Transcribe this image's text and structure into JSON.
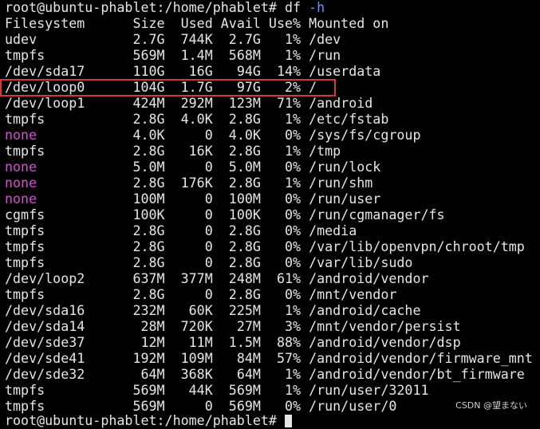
{
  "terminal": {
    "prompt": "root@ubuntu-phablet:/home/phablet# ",
    "command": "df ",
    "command_flag": "-h",
    "headers": [
      "Filesystem",
      "Size",
      "Used",
      "Avail",
      "Use%",
      "Mounted on"
    ],
    "highlighted_row_index": 3,
    "highlight_color": "#d23a3a",
    "none_color": "#d34fd3",
    "rows": [
      {
        "fs": "udev",
        "size": "2.7G",
        "used": "744K",
        "avail": "2.7G",
        "use": "1%",
        "mount": "/dev"
      },
      {
        "fs": "tmpfs",
        "size": "569M",
        "used": "1.4M",
        "avail": "568M",
        "use": "1%",
        "mount": "/run"
      },
      {
        "fs": "/dev/sda17",
        "size": "110G",
        "used": "16G",
        "avail": "94G",
        "use": "14%",
        "mount": "/userdata"
      },
      {
        "fs": "/dev/loop0",
        "size": "104G",
        "used": "1.7G",
        "avail": "97G",
        "use": "2%",
        "mount": "/"
      },
      {
        "fs": "/dev/loop1",
        "size": "424M",
        "used": "292M",
        "avail": "123M",
        "use": "71%",
        "mount": "/android"
      },
      {
        "fs": "tmpfs",
        "size": "2.8G",
        "used": "4.0K",
        "avail": "2.8G",
        "use": "1%",
        "mount": "/etc/fstab"
      },
      {
        "fs": "none",
        "size": "4.0K",
        "used": "0",
        "avail": "4.0K",
        "use": "0%",
        "mount": "/sys/fs/cgroup"
      },
      {
        "fs": "tmpfs",
        "size": "2.8G",
        "used": "16K",
        "avail": "2.8G",
        "use": "1%",
        "mount": "/tmp"
      },
      {
        "fs": "none",
        "size": "5.0M",
        "used": "0",
        "avail": "5.0M",
        "use": "0%",
        "mount": "/run/lock"
      },
      {
        "fs": "none",
        "size": "2.8G",
        "used": "176K",
        "avail": "2.8G",
        "use": "1%",
        "mount": "/run/shm"
      },
      {
        "fs": "none",
        "size": "100M",
        "used": "0",
        "avail": "100M",
        "use": "0%",
        "mount": "/run/user"
      },
      {
        "fs": "cgmfs",
        "size": "100K",
        "used": "0",
        "avail": "100K",
        "use": "0%",
        "mount": "/run/cgmanager/fs"
      },
      {
        "fs": "tmpfs",
        "size": "2.8G",
        "used": "0",
        "avail": "2.8G",
        "use": "0%",
        "mount": "/media"
      },
      {
        "fs": "tmpfs",
        "size": "2.8G",
        "used": "0",
        "avail": "2.8G",
        "use": "0%",
        "mount": "/var/lib/openvpn/chroot/tmp"
      },
      {
        "fs": "tmpfs",
        "size": "2.8G",
        "used": "0",
        "avail": "2.8G",
        "use": "0%",
        "mount": "/var/lib/sudo"
      },
      {
        "fs": "/dev/loop2",
        "size": "637M",
        "used": "377M",
        "avail": "248M",
        "use": "61%",
        "mount": "/android/vendor"
      },
      {
        "fs": "tmpfs",
        "size": "2.8G",
        "used": "0",
        "avail": "2.8G",
        "use": "0%",
        "mount": "/mnt/vendor"
      },
      {
        "fs": "/dev/sda16",
        "size": "232M",
        "used": "60K",
        "avail": "225M",
        "use": "1%",
        "mount": "/android/cache"
      },
      {
        "fs": "/dev/sda14",
        "size": "28M",
        "used": "720K",
        "avail": "27M",
        "use": "3%",
        "mount": "/mnt/vendor/persist"
      },
      {
        "fs": "/dev/sde37",
        "size": "12M",
        "used": "11M",
        "avail": "1.5M",
        "use": "88%",
        "mount": "/android/vendor/dsp"
      },
      {
        "fs": "/dev/sde41",
        "size": "192M",
        "used": "109M",
        "avail": "84M",
        "use": "57%",
        "mount": "/android/vendor/firmware_mnt"
      },
      {
        "fs": "/dev/sde32",
        "size": "64M",
        "used": "368K",
        "avail": "64M",
        "use": "1%",
        "mount": "/android/vendor/bt_firmware"
      },
      {
        "fs": "tmpfs",
        "size": "569M",
        "used": "44K",
        "avail": "569M",
        "use": "1%",
        "mount": "/run/user/32011"
      },
      {
        "fs": "tmpfs",
        "size": "569M",
        "used": "0",
        "avail": "569M",
        "use": "0%",
        "mount": "/run/user/0"
      }
    ],
    "next_prompt": "root@ubuntu-phablet:/home/phablet# "
  },
  "watermark": {
    "text": "CSDN @望まない"
  }
}
